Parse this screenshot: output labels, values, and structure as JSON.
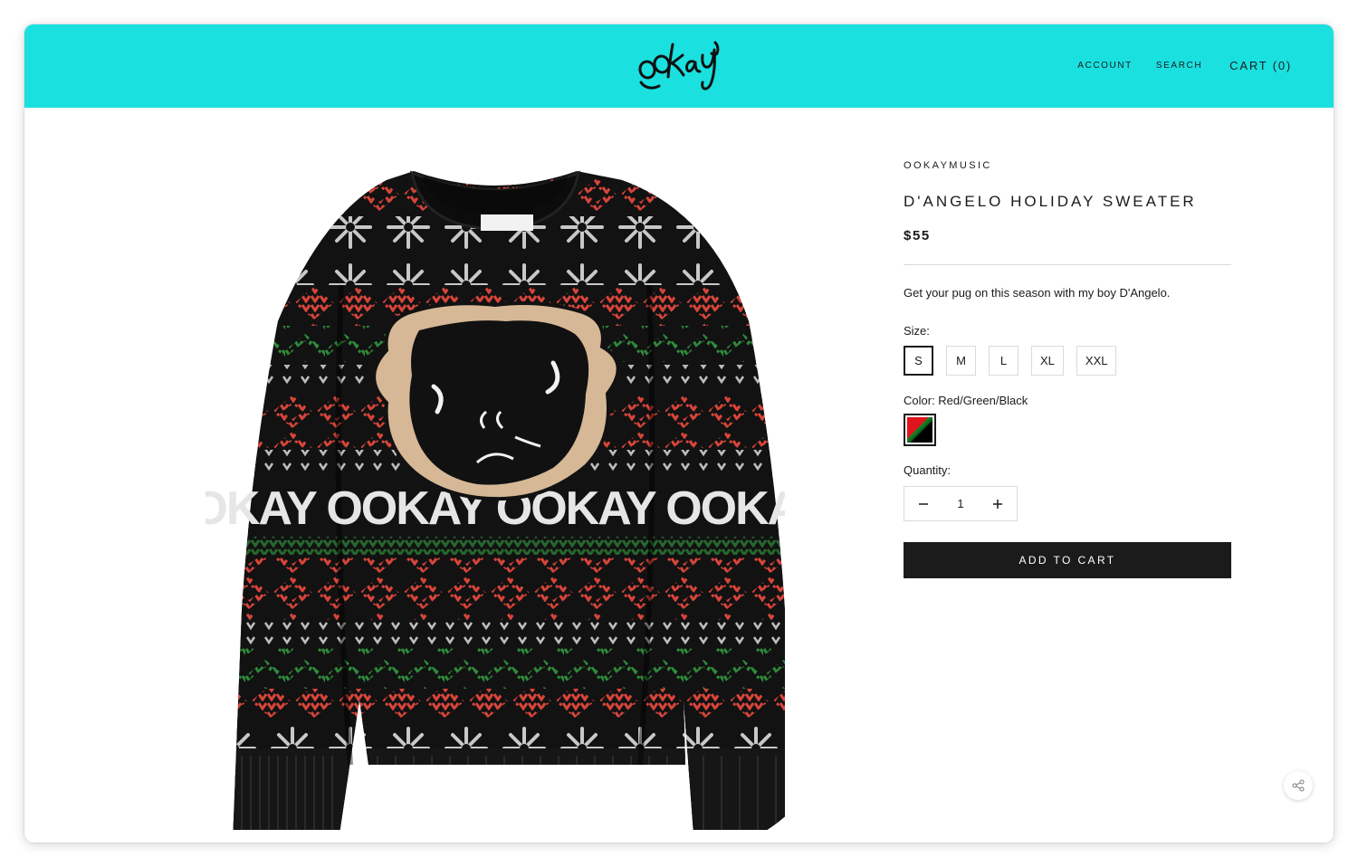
{
  "brand": {
    "logo_text": "ookay"
  },
  "nav": {
    "account": "Account",
    "search": "Search",
    "cart": "Cart (0)"
  },
  "product": {
    "vendor": "ookaymusic",
    "title": "D'Angelo Holiday Sweater",
    "price": "$55",
    "description": "Get your pug on this season with my boy D'Angelo.",
    "image_text": "OOKAY"
  },
  "options": {
    "size_label": "Size:",
    "sizes": [
      "S",
      "M",
      "L",
      "XL",
      "XXL"
    ],
    "selected_size": "S",
    "color_label": "Color: Red/Green/Black",
    "quantity_label": "Quantity:",
    "quantity": "1"
  },
  "actions": {
    "add_to_cart": "Add to cart"
  },
  "icons": [
    "minus-icon",
    "plus-icon",
    "share-icon"
  ],
  "colors": {
    "header": "#1ae0e0",
    "button": "#1c1b1b",
    "sweater": "#121212",
    "red": "#d8453a",
    "green": "#2f8a3a",
    "grey": "#c8c8c8",
    "pug_tan": "#d6b896"
  }
}
